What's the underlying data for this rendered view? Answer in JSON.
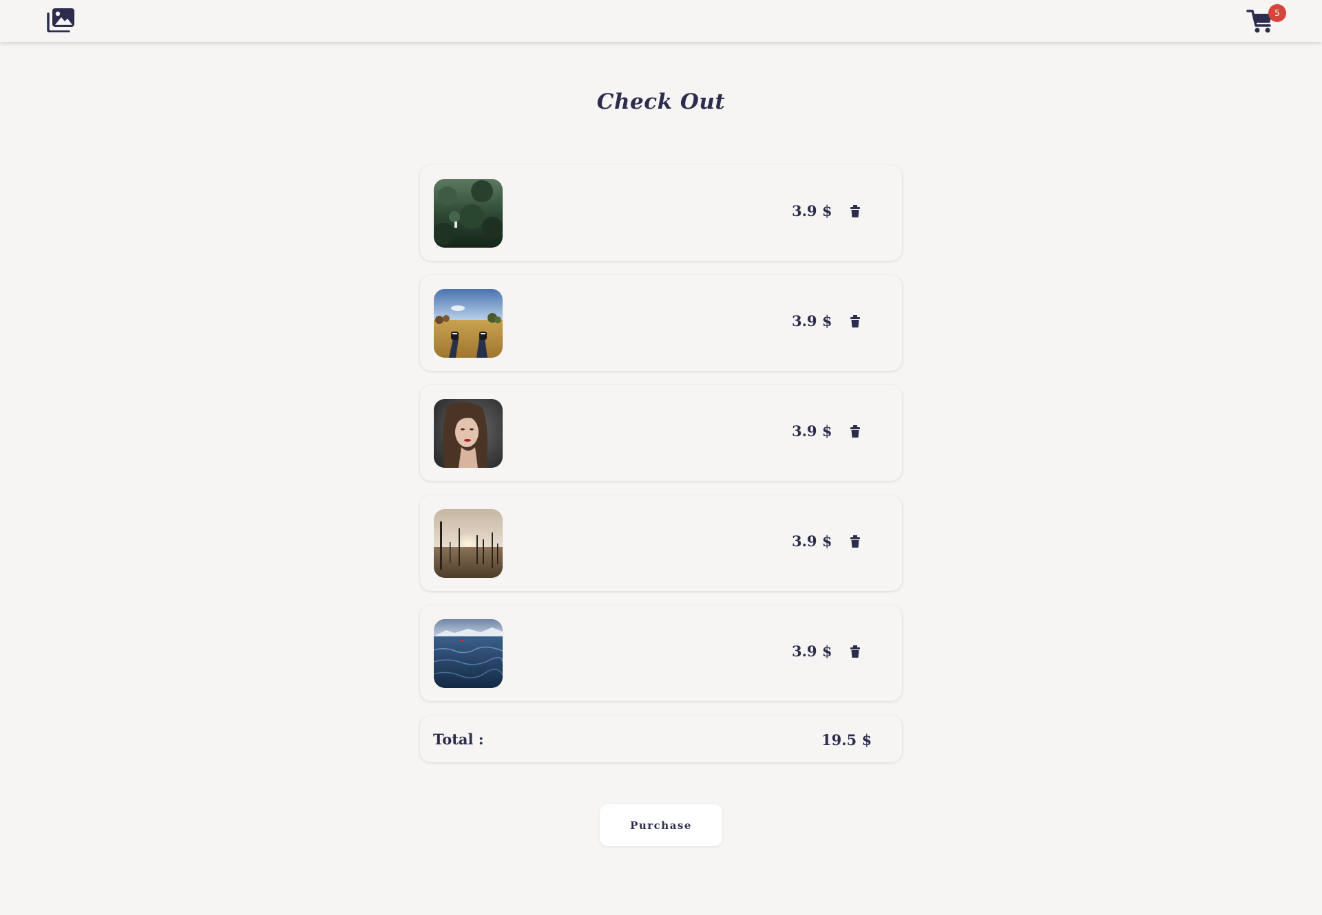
{
  "header": {
    "logo_icon": "images-gallery-icon",
    "cart_icon": "shopping-cart-icon",
    "cart_count": "5",
    "badge_color": "#d6453d"
  },
  "page": {
    "title": "Check Out"
  },
  "items": [
    {
      "thumbnail": "aerial view of a person standing in a dark green pine forest",
      "price": "3.9 $"
    },
    {
      "thumbnail": "legs in dark jeans and sneakers lying in a golden field under blue sky",
      "price": "3.9 $"
    },
    {
      "thumbnail": "portrait of a woman with long hair against a dark grey background",
      "price": "3.9 $"
    },
    {
      "thumbnail": "bare dead tree trunks in a misty field at sunrise",
      "price": "3.9 $"
    },
    {
      "thumbnail": "dark blue sea with snowy mountains and a small red boat",
      "price": "3.9 $"
    }
  ],
  "delete_icon": "trash-icon",
  "summary": {
    "total_label": "Total :",
    "total_value": "19.5 $"
  },
  "actions": {
    "purchase_label": "Purchase"
  },
  "colors": {
    "background": "#f6f5f4",
    "text": "#2c2d4d",
    "button_background": "#ffffff"
  }
}
